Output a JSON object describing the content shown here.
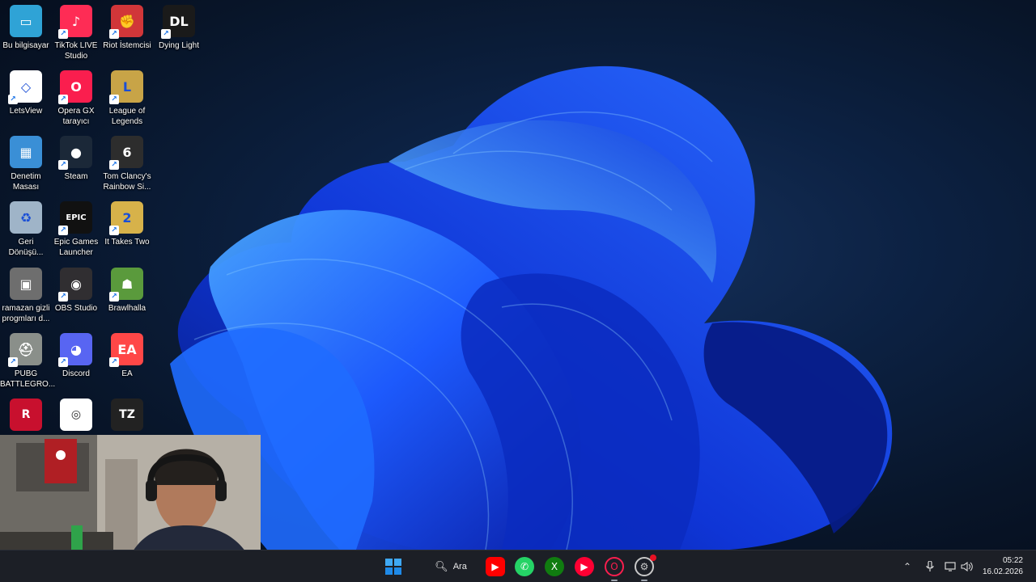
{
  "desktop_icons": [
    {
      "label": "Bu bilgisayar",
      "icon": "computer-icon",
      "color": "#2fa3d6"
    },
    {
      "label": "TikTok LIVE Studio",
      "icon": "tiktok-icon",
      "color": "#fe2c55"
    },
    {
      "label": "Riot İstemcisi",
      "icon": "riot-icon",
      "color": "#d13639"
    },
    {
      "label": "Dying Light",
      "icon": "dying-light-icon",
      "color": "#1a1a1a"
    },
    {
      "label": "LetsView",
      "icon": "letsview-icon",
      "color": "#ffffff"
    },
    {
      "label": "Opera GX tarayıcı",
      "icon": "opera-gx-icon",
      "color": "#fa1e4e"
    },
    {
      "label": "League of Legends",
      "icon": "league-icon",
      "color": "#c8a447"
    },
    {
      "label": "Denetim Masası",
      "icon": "control-panel-icon",
      "color": "#3a8fd6"
    },
    {
      "label": "Steam",
      "icon": "steam-icon",
      "color": "#1b2838"
    },
    {
      "label": "Tom Clancy's Rainbow Si...",
      "icon": "rainbow-six-icon",
      "color": "#2d2d2d"
    },
    {
      "label": "Geri Dönüşü...",
      "icon": "recycle-bin-icon",
      "color": "#9fb4c8"
    },
    {
      "label": "Epic Games Launcher",
      "icon": "epic-games-icon",
      "color": "#111111"
    },
    {
      "label": "It Takes Two",
      "icon": "it-takes-two-icon",
      "color": "#d7b24a"
    },
    {
      "label": "ramazan gizli progmları d...",
      "icon": "camera-folder-icon",
      "color": "#6e6e6e"
    },
    {
      "label": "OBS Studio",
      "icon": "obs-icon",
      "color": "#302e31"
    },
    {
      "label": "Brawlhalla",
      "icon": "brawlhalla-icon",
      "color": "#5a9a3c"
    },
    {
      "label": "PUBG BATTLEGRO...",
      "icon": "pubg-icon",
      "color": "#8a8f8a"
    },
    {
      "label": "Discord",
      "icon": "discord-icon",
      "color": "#5865f2"
    },
    {
      "label": "EA",
      "icon": "ea-icon",
      "color": "#ff4747"
    }
  ],
  "partial_icons": [
    {
      "icon": "red-dead-icon",
      "color": "#c8102e"
    },
    {
      "icon": "ubisoft-icon",
      "color": "#ffffff"
    },
    {
      "icon": "tzar-icon",
      "color": "#222222"
    }
  ],
  "taskbar": {
    "search_label": "Ara",
    "apps": [
      {
        "icon": "youtube-icon",
        "color": "#ff0000"
      },
      {
        "icon": "whatsapp-icon",
        "color": "#25d366"
      },
      {
        "icon": "xbox-icon",
        "color": "#107c10"
      },
      {
        "icon": "youtube-music-icon",
        "color": "#ff0033"
      },
      {
        "icon": "opera-gx-icon",
        "color": "#fa1e4e"
      },
      {
        "icon": "settings-app-icon",
        "color": "#c8c8c8"
      }
    ],
    "time": "05:22",
    "date": "16.02.2026"
  }
}
